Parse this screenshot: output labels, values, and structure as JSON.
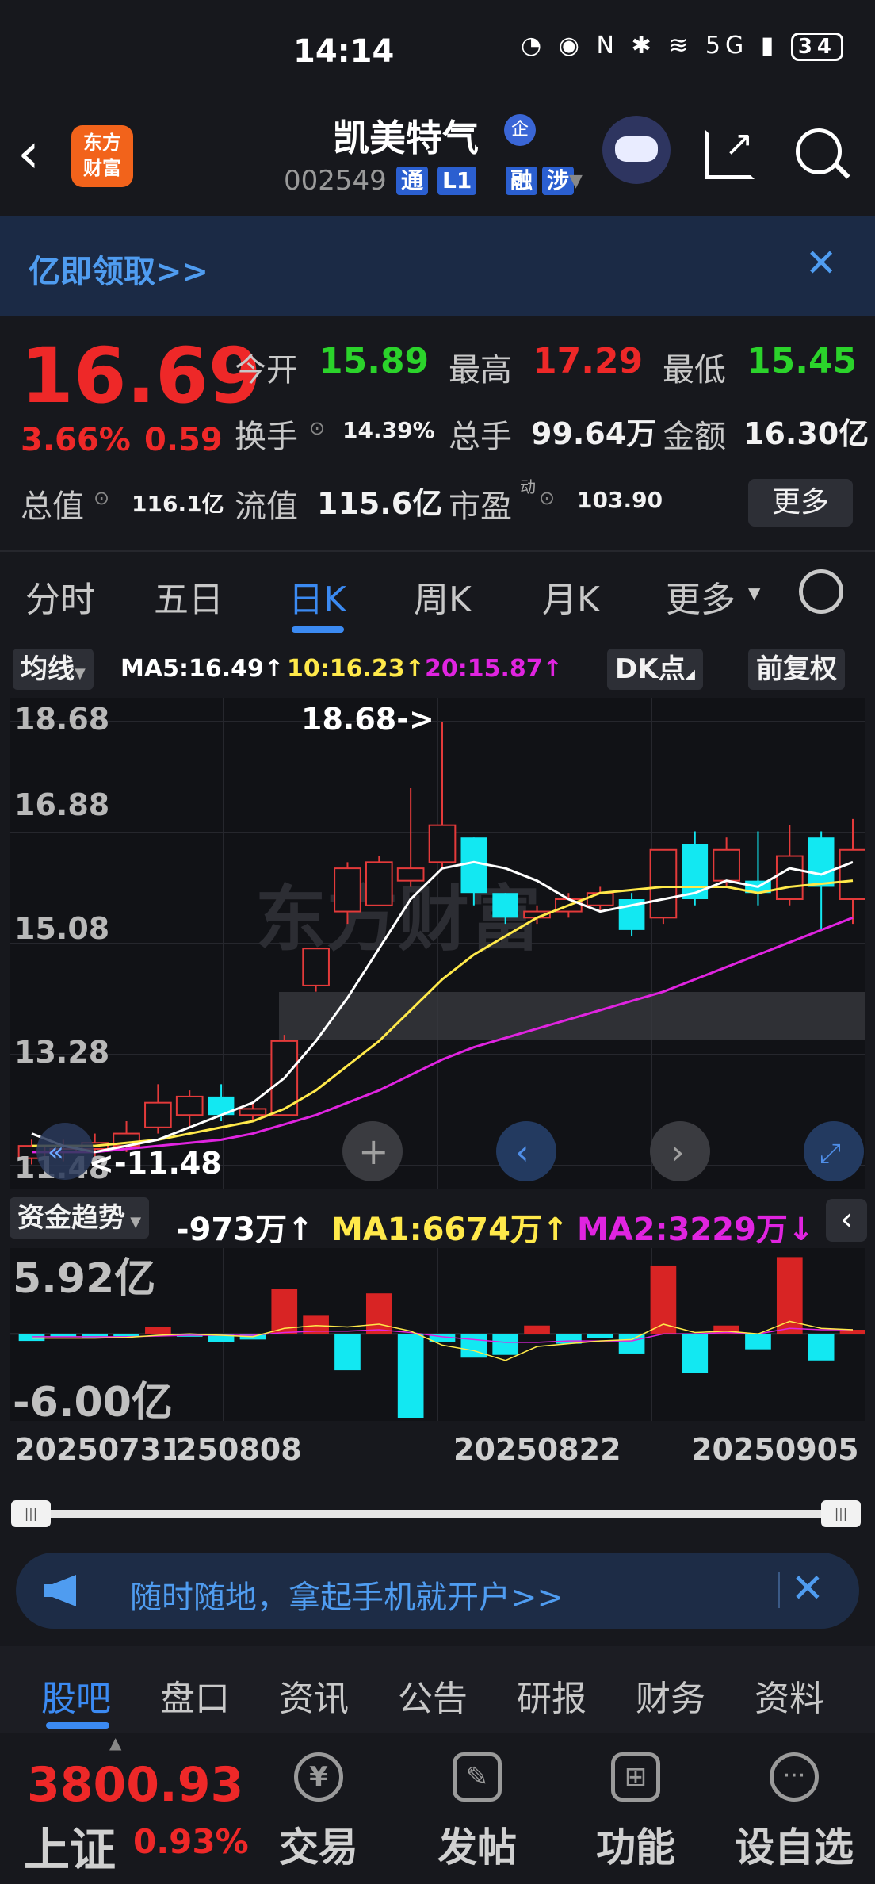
{
  "status": {
    "time": "14:14",
    "battery": "34",
    "network": "5G"
  },
  "header": {
    "stock_name": "凯美特气",
    "enterprise_badge": "企",
    "code": "002549",
    "tags": [
      "通",
      "L1",
      "融",
      "涉"
    ],
    "logo_lines": [
      "东方",
      "财富"
    ]
  },
  "banner": {
    "text": "亿即领取>>"
  },
  "quote": {
    "price": "16.69",
    "change_pct": "3.66%",
    "change_amt": "0.59",
    "open_label": "今开",
    "open": "15.89",
    "high_label": "最高",
    "high": "17.29",
    "low_label": "最低",
    "low": "15.45",
    "turnover_label": "换手",
    "turnover": "14.39%",
    "volume_label": "总手",
    "volume": "99.64万",
    "amount_label": "金额",
    "amount": "16.30亿",
    "mktcap_label": "总值",
    "mktcap": "116.1亿",
    "float_label": "流值",
    "float": "115.6亿",
    "pe_label": "市盈",
    "pe_sup": "动",
    "pe": "103.90",
    "more": "更多"
  },
  "period_tabs": [
    "分时",
    "五日",
    "日K",
    "周K",
    "月K",
    "更多"
  ],
  "ma_bar": {
    "selector": "均线",
    "ma5": "MA5:16.49↑",
    "ma10": "10:16.23↑",
    "ma20": "20:15.87↑",
    "dk": "DK点",
    "adjust": "前复权",
    "colors": {
      "ma5": "#ffffff",
      "ma10": "#ffe94a",
      "ma20": "#e024e0",
      "up": "#e33a3a",
      "down": "#12e8f2"
    }
  },
  "kline": {
    "price_labels": [
      "18.68",
      "16.88",
      "15.08",
      "13.28",
      "11.48"
    ],
    "max_note": "18.68->",
    "min_note": "<-11.48",
    "watermark": "东方财富"
  },
  "indicator_bar": {
    "selector": "资金趋势",
    "value": "-973万↑",
    "ma1": "MA1:6674万↑",
    "ma2": "MA2:3229万↓"
  },
  "flow": {
    "top_label": "5.92亿",
    "bottom_label": "-6.00亿"
  },
  "x_axis": [
    "20250731",
    "250808",
    "20250822",
    "20250905"
  ],
  "promo": {
    "text": "随时随地，拿起手机就开户>>"
  },
  "bottom_tabs": [
    "股吧",
    "盘口",
    "资讯",
    "公告",
    "研报",
    "财务",
    "资料"
  ],
  "bottom_bar": {
    "index_value": "3800.93",
    "index_name": "上证",
    "index_pct": "0.93%",
    "nav": [
      "交易",
      "发帖",
      "功能",
      "设自选"
    ]
  },
  "chart_data": {
    "type": "candlestick",
    "ylim": [
      11.48,
      18.68
    ],
    "candles": [
      {
        "o": 11.6,
        "c": 11.8,
        "h": 11.9,
        "l": 11.5
      },
      {
        "o": 11.7,
        "c": 11.75,
        "h": 11.9,
        "l": 11.55
      },
      {
        "o": 11.75,
        "c": 11.85,
        "h": 12.0,
        "l": 11.6
      },
      {
        "o": 11.8,
        "c": 12.0,
        "h": 12.2,
        "l": 11.7
      },
      {
        "o": 12.1,
        "c": 12.5,
        "h": 12.8,
        "l": 12.0
      },
      {
        "o": 12.3,
        "c": 12.6,
        "h": 12.7,
        "l": 12.1
      },
      {
        "o": 12.6,
        "c": 12.3,
        "h": 12.8,
        "l": 12.2
      },
      {
        "o": 12.3,
        "c": 12.4,
        "h": 12.5,
        "l": 12.2
      },
      {
        "o": 12.3,
        "c": 13.5,
        "h": 13.6,
        "l": 12.3
      },
      {
        "o": 14.4,
        "c": 15.0,
        "h": 15.0,
        "l": 14.3
      },
      {
        "o": 15.6,
        "c": 16.3,
        "h": 16.4,
        "l": 15.4
      },
      {
        "o": 15.7,
        "c": 16.4,
        "h": 16.5,
        "l": 15.7
      },
      {
        "o": 16.1,
        "c": 16.3,
        "h": 17.6,
        "l": 16.0
      },
      {
        "o": 16.4,
        "c": 17.0,
        "h": 18.68,
        "l": 16.3
      },
      {
        "o": 16.8,
        "c": 15.9,
        "h": 16.8,
        "l": 15.7
      },
      {
        "o": 15.9,
        "c": 15.5,
        "h": 15.9,
        "l": 15.4
      },
      {
        "o": 15.5,
        "c": 15.6,
        "h": 15.7,
        "l": 15.4
      },
      {
        "o": 15.6,
        "c": 15.8,
        "h": 15.9,
        "l": 15.5
      },
      {
        "o": 15.7,
        "c": 15.9,
        "h": 16.0,
        "l": 15.6
      },
      {
        "o": 15.8,
        "c": 15.3,
        "h": 15.9,
        "l": 15.2
      },
      {
        "o": 15.5,
        "c": 16.6,
        "h": 16.6,
        "l": 15.4
      },
      {
        "o": 16.7,
        "c": 15.8,
        "h": 16.9,
        "l": 15.7
      },
      {
        "o": 16.1,
        "c": 16.6,
        "h": 16.8,
        "l": 16.0
      },
      {
        "o": 16.1,
        "c": 15.9,
        "h": 16.9,
        "l": 15.7
      },
      {
        "o": 15.8,
        "c": 16.5,
        "h": 17.0,
        "l": 15.7
      },
      {
        "o": 16.8,
        "c": 16.0,
        "h": 16.9,
        "l": 15.3
      },
      {
        "o": 15.8,
        "c": 16.6,
        "h": 17.1,
        "l": 15.4
      }
    ],
    "ma5": [
      12.0,
      11.8,
      11.7,
      11.8,
      11.9,
      12.1,
      12.3,
      12.5,
      12.9,
      13.5,
      14.2,
      15.0,
      15.8,
      16.3,
      16.4,
      16.3,
      16.1,
      15.8,
      15.6,
      15.7,
      15.8,
      15.9,
      16.1,
      16.0,
      16.3,
      16.2,
      16.4
    ],
    "ma10": [
      11.8,
      11.8,
      11.8,
      11.85,
      11.9,
      12.0,
      12.1,
      12.2,
      12.4,
      12.7,
      13.1,
      13.5,
      14.0,
      14.5,
      14.9,
      15.2,
      15.5,
      15.7,
      15.9,
      15.95,
      16.0,
      16.0,
      16.0,
      15.9,
      16.0,
      16.05,
      16.1
    ],
    "ma20": [
      11.7,
      11.7,
      11.7,
      11.75,
      11.8,
      11.85,
      11.9,
      12.0,
      12.15,
      12.3,
      12.5,
      12.7,
      12.95,
      13.2,
      13.4,
      13.55,
      13.7,
      13.85,
      14.0,
      14.15,
      14.3,
      14.5,
      14.7,
      14.9,
      15.1,
      15.3,
      15.5
    ],
    "flow_ylim": [
      -6.0,
      5.92
    ],
    "flow": [
      -0.5,
      -0.2,
      -0.3,
      -0.2,
      0.5,
      -0.2,
      -0.6,
      -0.4,
      3.2,
      1.3,
      -2.6,
      2.9,
      -6.0,
      -0.6,
      -1.7,
      -1.5,
      0.6,
      -0.7,
      -0.3,
      -1.4,
      4.9,
      -2.8,
      0.6,
      -1.1,
      5.5,
      -1.9,
      0.3
    ],
    "flow_ma1": [
      -0.3,
      -0.3,
      -0.3,
      -0.25,
      -0.1,
      0.0,
      -0.1,
      -0.2,
      0.4,
      0.6,
      0.5,
      0.7,
      0.2,
      -0.8,
      -1.2,
      -1.9,
      -0.9,
      -0.7,
      -0.5,
      -0.4,
      0.7,
      0.1,
      0.2,
      0.0,
      0.9,
      0.4,
      0.3
    ],
    "flow_ma2": [
      -0.2,
      -0.2,
      -0.2,
      -0.2,
      -0.15,
      -0.1,
      -0.1,
      -0.1,
      0.1,
      0.2,
      0.2,
      0.3,
      0.1,
      -0.2,
      -0.4,
      -0.6,
      -0.6,
      -0.5,
      -0.5,
      -0.5,
      0.0,
      0.0,
      0.1,
      0.0,
      0.4,
      0.3,
      0.3
    ]
  }
}
